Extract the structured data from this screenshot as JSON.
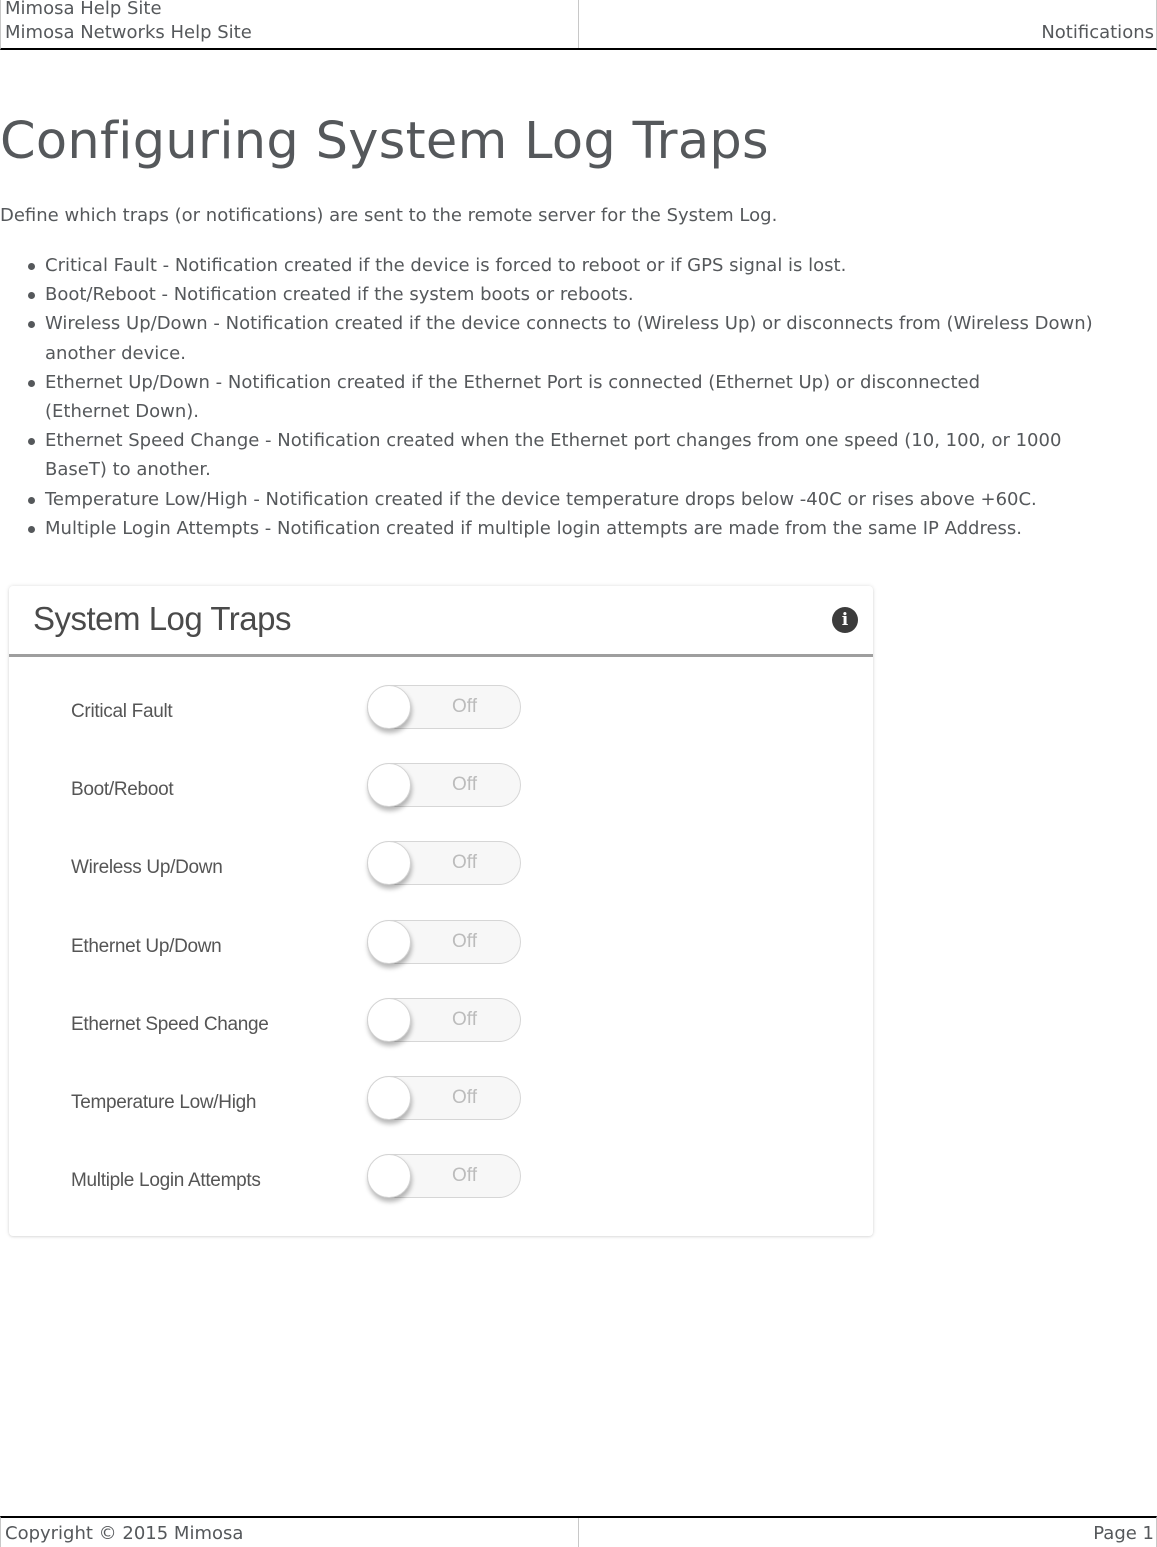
{
  "header": {
    "site_name": "Mimosa Help Site",
    "site_subtitle": "Mimosa Networks Help Site",
    "chapter": "Notifications"
  },
  "content": {
    "title": "Configuring System Log Traps",
    "intro": "Define which traps (or notifications) are sent to the remote server for the System Log.",
    "bullets": [
      "Critical Fault - Notification created if the device is forced to reboot or if GPS signal is lost.",
      "Boot/Reboot - Notification created if the system boots or reboots.",
      "Wireless Up/Down - Notification created if the device connects to (Wireless Up) or disconnects from (Wireless Down) another device.",
      "Ethernet Up/Down - Notification created if the Ethernet Port is connected (Ethernet Up) or disconnected (Ethernet Down).",
      "Ethernet Speed Change - Notification created when the Ethernet port changes from one speed (10, 100, or 1000 BaseT) to another.",
      "Temperature Low/High - Notification created if the device temperature drops below -40C or rises above +60C.",
      "Multiple Login Attempts - Notification created if multiple login attempts are made from the same IP Address."
    ]
  },
  "panel": {
    "title": "System Log Traps",
    "info_icon": "info-circle-icon",
    "info_glyph": "i",
    "traps": [
      {
        "label": "Critical Fault",
        "state": "Off"
      },
      {
        "label": "Boot/Reboot",
        "state": "Off"
      },
      {
        "label": "Wireless Up/Down",
        "state": "Off"
      },
      {
        "label": "Ethernet Up/Down",
        "state": "Off"
      },
      {
        "label": "Ethernet Speed Change",
        "state": "Off"
      },
      {
        "label": "Temperature Low/High",
        "state": "Off"
      },
      {
        "label": "Multiple Login Attempts",
        "state": "Off"
      }
    ]
  },
  "footer": {
    "copyright": "Copyright © 2015 Mimosa",
    "page": "Page 1"
  }
}
